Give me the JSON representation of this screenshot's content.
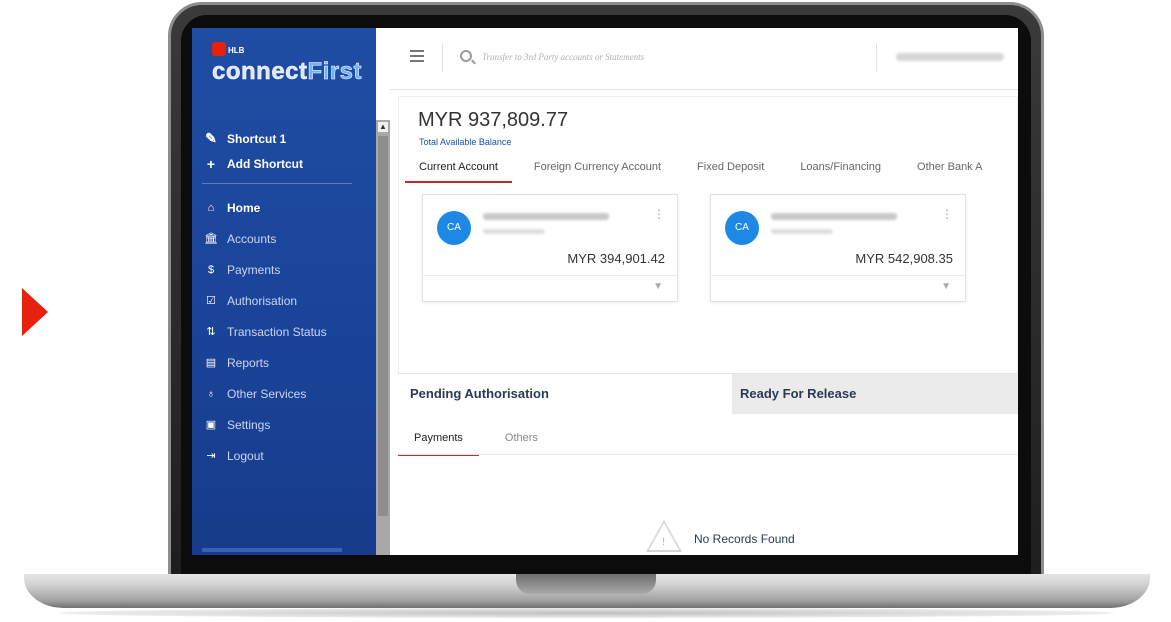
{
  "brand": {
    "small": "HLB",
    "name_part1": "connect",
    "name_part2": "First"
  },
  "sidebar": {
    "shortcuts": [
      {
        "label": "Shortcut 1",
        "icon": "pencil-icon"
      },
      {
        "label": "Add Shortcut",
        "icon": "plus-icon"
      }
    ],
    "items": [
      {
        "label": "Home",
        "icon": "home-icon",
        "active": true
      },
      {
        "label": "Accounts",
        "icon": "bank-icon"
      },
      {
        "label": "Payments",
        "icon": "dollar-icon"
      },
      {
        "label": "Authorisation",
        "icon": "check-box-icon"
      },
      {
        "label": "Transaction Status",
        "icon": "transfer-icon"
      },
      {
        "label": "Reports",
        "icon": "document-icon"
      },
      {
        "label": "Other Services",
        "icon": "hand-coin-icon"
      },
      {
        "label": "Settings",
        "icon": "settings-icon"
      },
      {
        "label": "Logout",
        "icon": "logout-icon"
      }
    ]
  },
  "topbar": {
    "search_placeholder": "Transfer to 3rd Party accounts or Statements"
  },
  "balance": {
    "amount": "MYR 937,809.77",
    "label": "Total Available Balance"
  },
  "tabs": [
    "Current Account",
    "Foreign Currency Account",
    "Fixed Deposit",
    "Loans/Financing",
    "Other Bank A"
  ],
  "accounts": [
    {
      "avatar": "CA",
      "balance": "MYR 394,901.42"
    },
    {
      "avatar": "CA",
      "balance": "MYR 542,908.35"
    }
  ],
  "authorisation": {
    "pending_label": "Pending Authorisation",
    "release_label": "Ready For Release",
    "sub_tabs": [
      "Payments",
      "Others"
    ],
    "empty_text": "No Records Found"
  },
  "colors": {
    "sidebar": "#1a4398",
    "accent_red": "#c32a2a",
    "avatar_blue": "#1e88e5",
    "arrow_red": "#e8210f"
  }
}
